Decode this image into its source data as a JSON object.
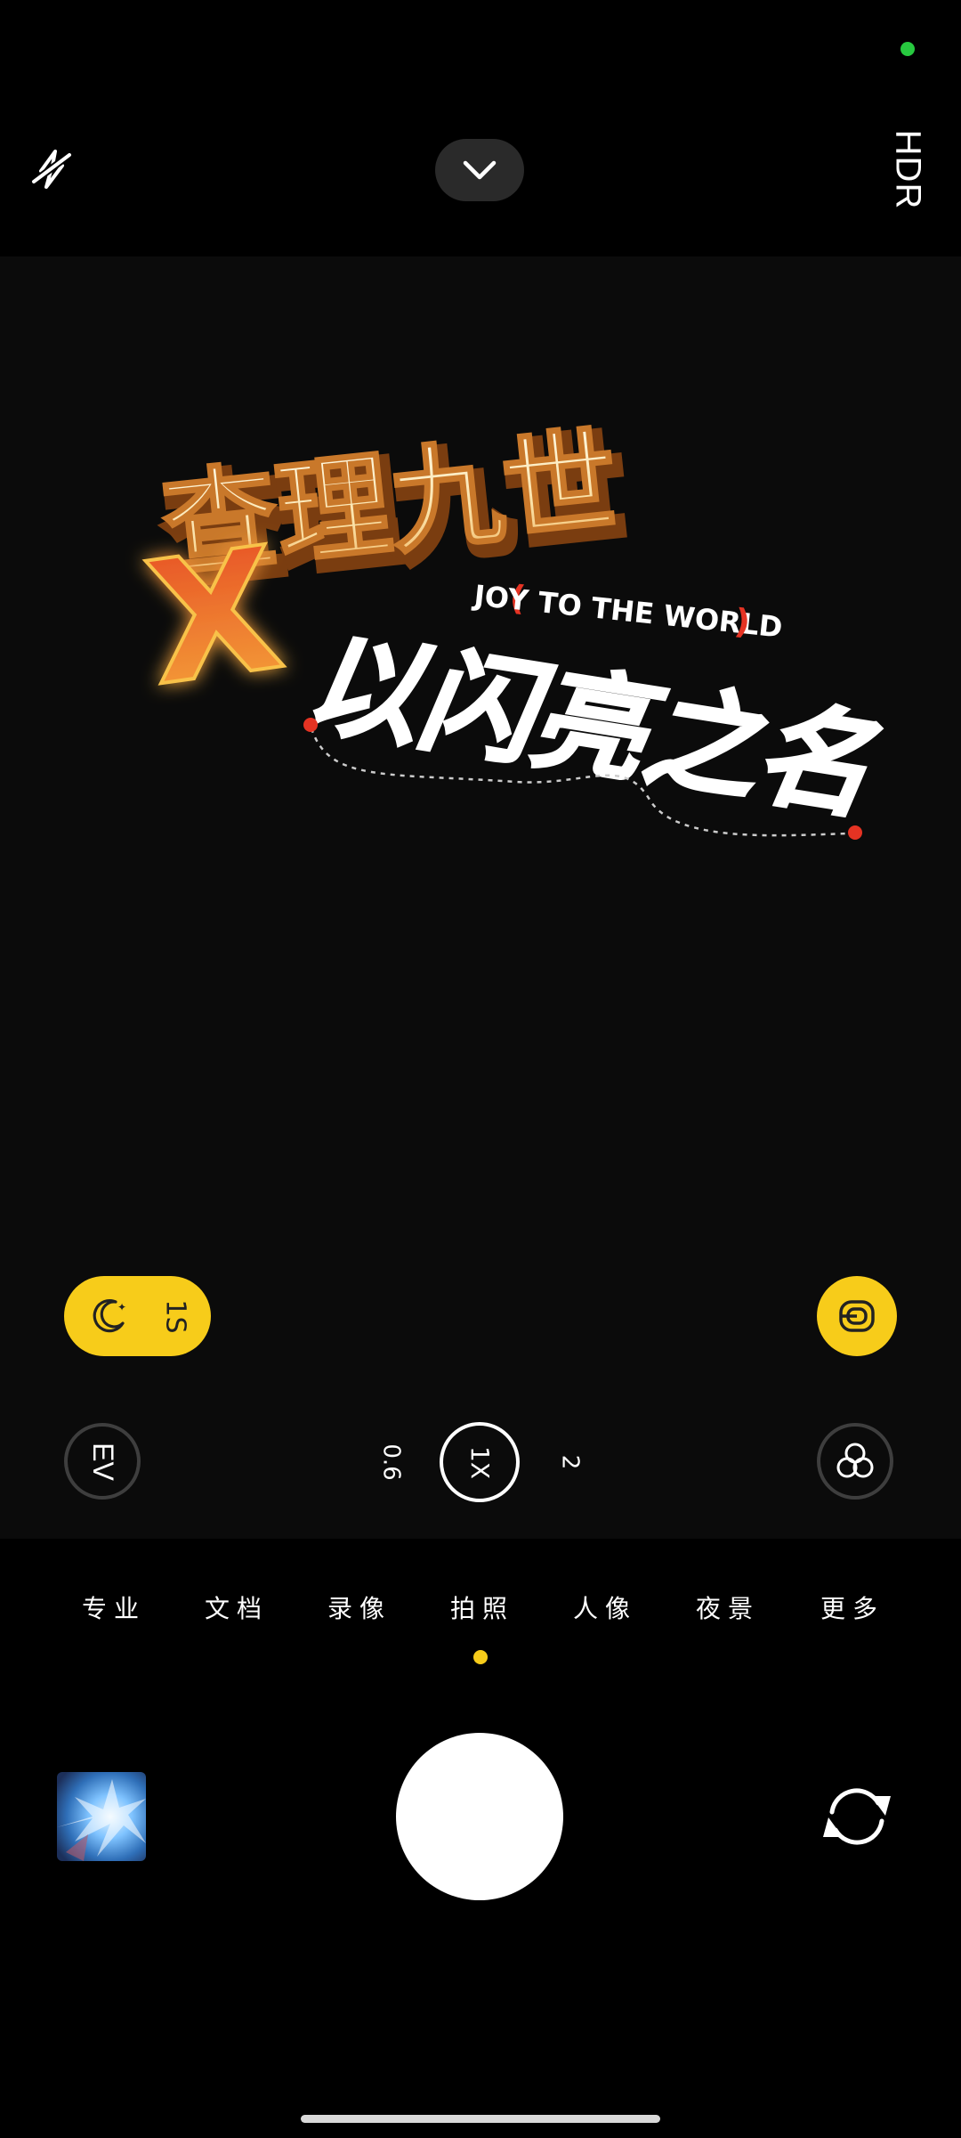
{
  "top_bar": {
    "flash_icon": "flash-off-icon",
    "collapse_icon": "chevron-down-icon",
    "hdr_label": "HDR"
  },
  "viewfinder": {
    "poster": {
      "title": "查理九世",
      "cross": "X",
      "tagline": "JOY TO THE WORLD",
      "subtitle": "以闪亮之名"
    }
  },
  "night_mode": {
    "icon": "moon-icon",
    "duration": "1S"
  },
  "stabilize": {
    "icon": "stabilization-icon"
  },
  "exposure": {
    "label": "EV"
  },
  "zoom": {
    "options": [
      "0.6",
      "1X",
      "2"
    ],
    "selected": "1X"
  },
  "filter": {
    "icon": "filter-circles-icon"
  },
  "modes": {
    "items": [
      "专业",
      "文档",
      "录像",
      "拍照",
      "人像",
      "夜景",
      "更多"
    ],
    "active": "拍照"
  },
  "bottom": {
    "gallery_icon": "gallery-thumbnail",
    "shutter_icon": "shutter-button",
    "flip_icon": "camera-flip-icon"
  },
  "colors": {
    "accent": "#f7cc1a",
    "privacy_dot": "#27c93f",
    "background": "#000000"
  }
}
